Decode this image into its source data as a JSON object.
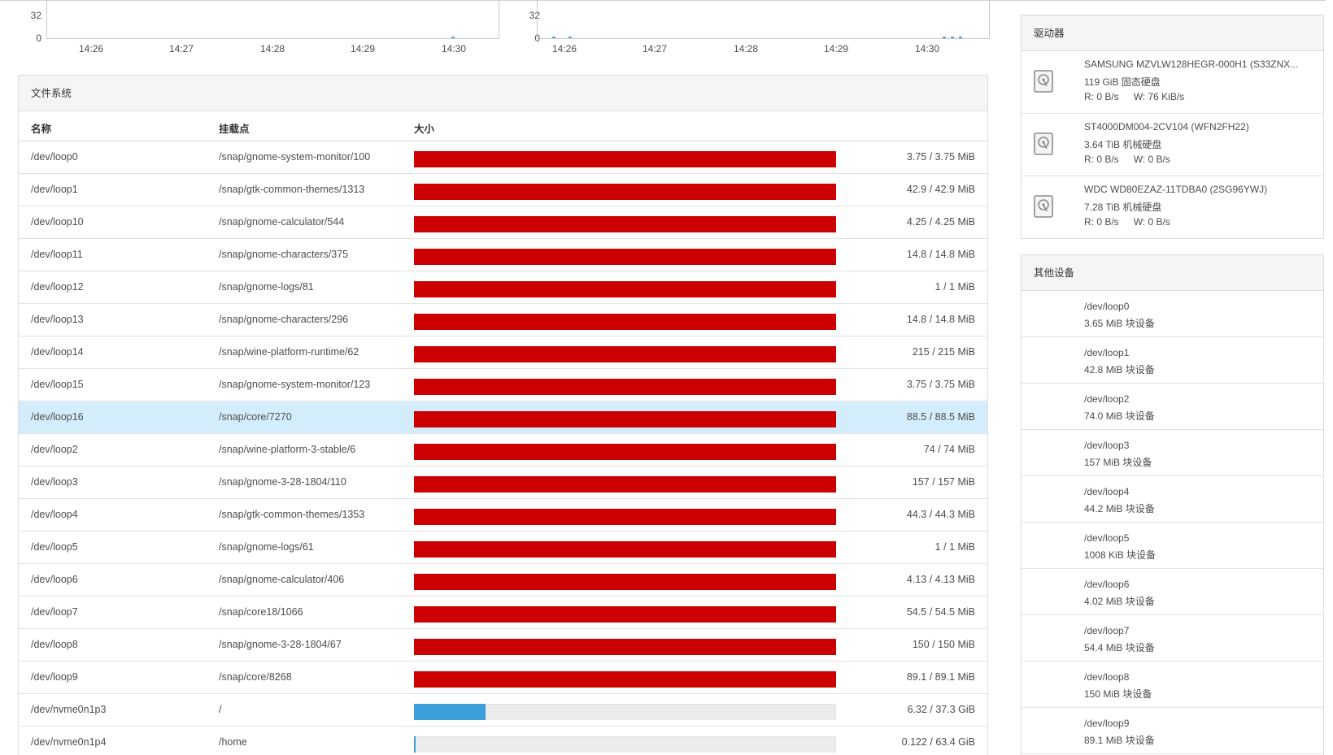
{
  "charts": [
    {
      "y_ticks": [
        "32",
        "0"
      ],
      "x_ticks": [
        "14:26",
        "14:27",
        "14:28",
        "14:29",
        "14:30"
      ]
    },
    {
      "y_ticks": [
        "32",
        "0"
      ],
      "x_ticks": [
        "14:26",
        "14:27",
        "14:28",
        "14:29",
        "14:30"
      ]
    }
  ],
  "filesystem": {
    "title": "文件系统",
    "columns": {
      "name": "名称",
      "mount": "挂载点",
      "size": "大小"
    },
    "rows": [
      {
        "name": "/dev/loop0",
        "mount": "/snap/gnome-system-monitor/100",
        "size": "3.75 / 3.75 MiB",
        "used_fraction": 1.0,
        "status": "full"
      },
      {
        "name": "/dev/loop1",
        "mount": "/snap/gtk-common-themes/1313",
        "size": "42.9 / 42.9 MiB",
        "used_fraction": 1.0,
        "status": "full"
      },
      {
        "name": "/dev/loop10",
        "mount": "/snap/gnome-calculator/544",
        "size": "4.25 / 4.25 MiB",
        "used_fraction": 1.0,
        "status": "full"
      },
      {
        "name": "/dev/loop11",
        "mount": "/snap/gnome-characters/375",
        "size": "14.8 / 14.8 MiB",
        "used_fraction": 1.0,
        "status": "full"
      },
      {
        "name": "/dev/loop12",
        "mount": "/snap/gnome-logs/81",
        "size": "1 / 1 MiB",
        "used_fraction": 1.0,
        "status": "full"
      },
      {
        "name": "/dev/loop13",
        "mount": "/snap/gnome-characters/296",
        "size": "14.8 / 14.8 MiB",
        "used_fraction": 1.0,
        "status": "full"
      },
      {
        "name": "/dev/loop14",
        "mount": "/snap/wine-platform-runtime/62",
        "size": "215 / 215 MiB",
        "used_fraction": 1.0,
        "status": "full"
      },
      {
        "name": "/dev/loop15",
        "mount": "/snap/gnome-system-monitor/123",
        "size": "3.75 / 3.75 MiB",
        "used_fraction": 1.0,
        "status": "full"
      },
      {
        "name": "/dev/loop16",
        "mount": "/snap/core/7270",
        "size": "88.5 / 88.5 MiB",
        "used_fraction": 1.0,
        "status": "full",
        "selected": true
      },
      {
        "name": "/dev/loop2",
        "mount": "/snap/wine-platform-3-stable/6",
        "size": "74 / 74 MiB",
        "used_fraction": 1.0,
        "status": "full"
      },
      {
        "name": "/dev/loop3",
        "mount": "/snap/gnome-3-28-1804/110",
        "size": "157 / 157 MiB",
        "used_fraction": 1.0,
        "status": "full"
      },
      {
        "name": "/dev/loop4",
        "mount": "/snap/gtk-common-themes/1353",
        "size": "44.3 / 44.3 MiB",
        "used_fraction": 1.0,
        "status": "full"
      },
      {
        "name": "/dev/loop5",
        "mount": "/snap/gnome-logs/61",
        "size": "1 / 1 MiB",
        "used_fraction": 1.0,
        "status": "full"
      },
      {
        "name": "/dev/loop6",
        "mount": "/snap/gnome-calculator/406",
        "size": "4.13 / 4.13 MiB",
        "used_fraction": 1.0,
        "status": "full"
      },
      {
        "name": "/dev/loop7",
        "mount": "/snap/core18/1066",
        "size": "54.5 / 54.5 MiB",
        "used_fraction": 1.0,
        "status": "full"
      },
      {
        "name": "/dev/loop8",
        "mount": "/snap/gnome-3-28-1804/67",
        "size": "150 / 150 MiB",
        "used_fraction": 1.0,
        "status": "full"
      },
      {
        "name": "/dev/loop9",
        "mount": "/snap/core/8268",
        "size": "89.1 / 89.1 MiB",
        "used_fraction": 1.0,
        "status": "full"
      },
      {
        "name": "/dev/nvme0n1p3",
        "mount": "/",
        "size": "6.32 / 37.3 GiB",
        "used_fraction": 0.169,
        "status": "ok"
      },
      {
        "name": "/dev/nvme0n1p4",
        "mount": "/home",
        "size": "0.122 / 63.4 GiB",
        "used_fraction": 0.002,
        "status": "ok"
      }
    ]
  },
  "drives": {
    "title": "驱动器",
    "items": [
      {
        "icon": "disk-icon",
        "name": "SAMSUNG MZVLW128HEGR-000H1 (S33ZNX...",
        "desc": "119 GiB 固态硬盘",
        "read": "R: 0 B/s",
        "write": "W: 76 KiB/s"
      },
      {
        "icon": "disk-icon",
        "name": "ST4000DM004-2CV104 (WFN2FH22)",
        "desc": "3.64 TiB 机械硬盘",
        "read": "R: 0 B/s",
        "write": "W: 0 B/s"
      },
      {
        "icon": "disk-icon",
        "name": "WDC WD80EZAZ-11TDBA0 (2SG96YWJ)",
        "desc": "7.28 TiB 机械硬盘",
        "read": "R: 0 B/s",
        "write": "W: 0 B/s"
      }
    ]
  },
  "other_devices": {
    "title": "其他设备",
    "items": [
      {
        "name": "/dev/loop0",
        "desc": "3.65 MiB 块设备"
      },
      {
        "name": "/dev/loop1",
        "desc": "42.8 MiB 块设备"
      },
      {
        "name": "/dev/loop2",
        "desc": "74.0 MiB 块设备"
      },
      {
        "name": "/dev/loop3",
        "desc": "157 MiB 块设备"
      },
      {
        "name": "/dev/loop4",
        "desc": "44.2 MiB 块设备"
      },
      {
        "name": "/dev/loop5",
        "desc": "1008 KiB 块设备"
      },
      {
        "name": "/dev/loop6",
        "desc": "4.02 MiB 块设备"
      },
      {
        "name": "/dev/loop7",
        "desc": "54.4 MiB 块设备"
      },
      {
        "name": "/dev/loop8",
        "desc": "150 MiB 块设备"
      },
      {
        "name": "/dev/loop9",
        "desc": "89.1 MiB 块设备"
      }
    ]
  },
  "colors": {
    "bar_full": "#cc0000",
    "bar_ok": "#3a9fdb",
    "bar_track": "#ececec",
    "selected_row": "#d4edfc",
    "panel_header": "#f5f5f5"
  }
}
